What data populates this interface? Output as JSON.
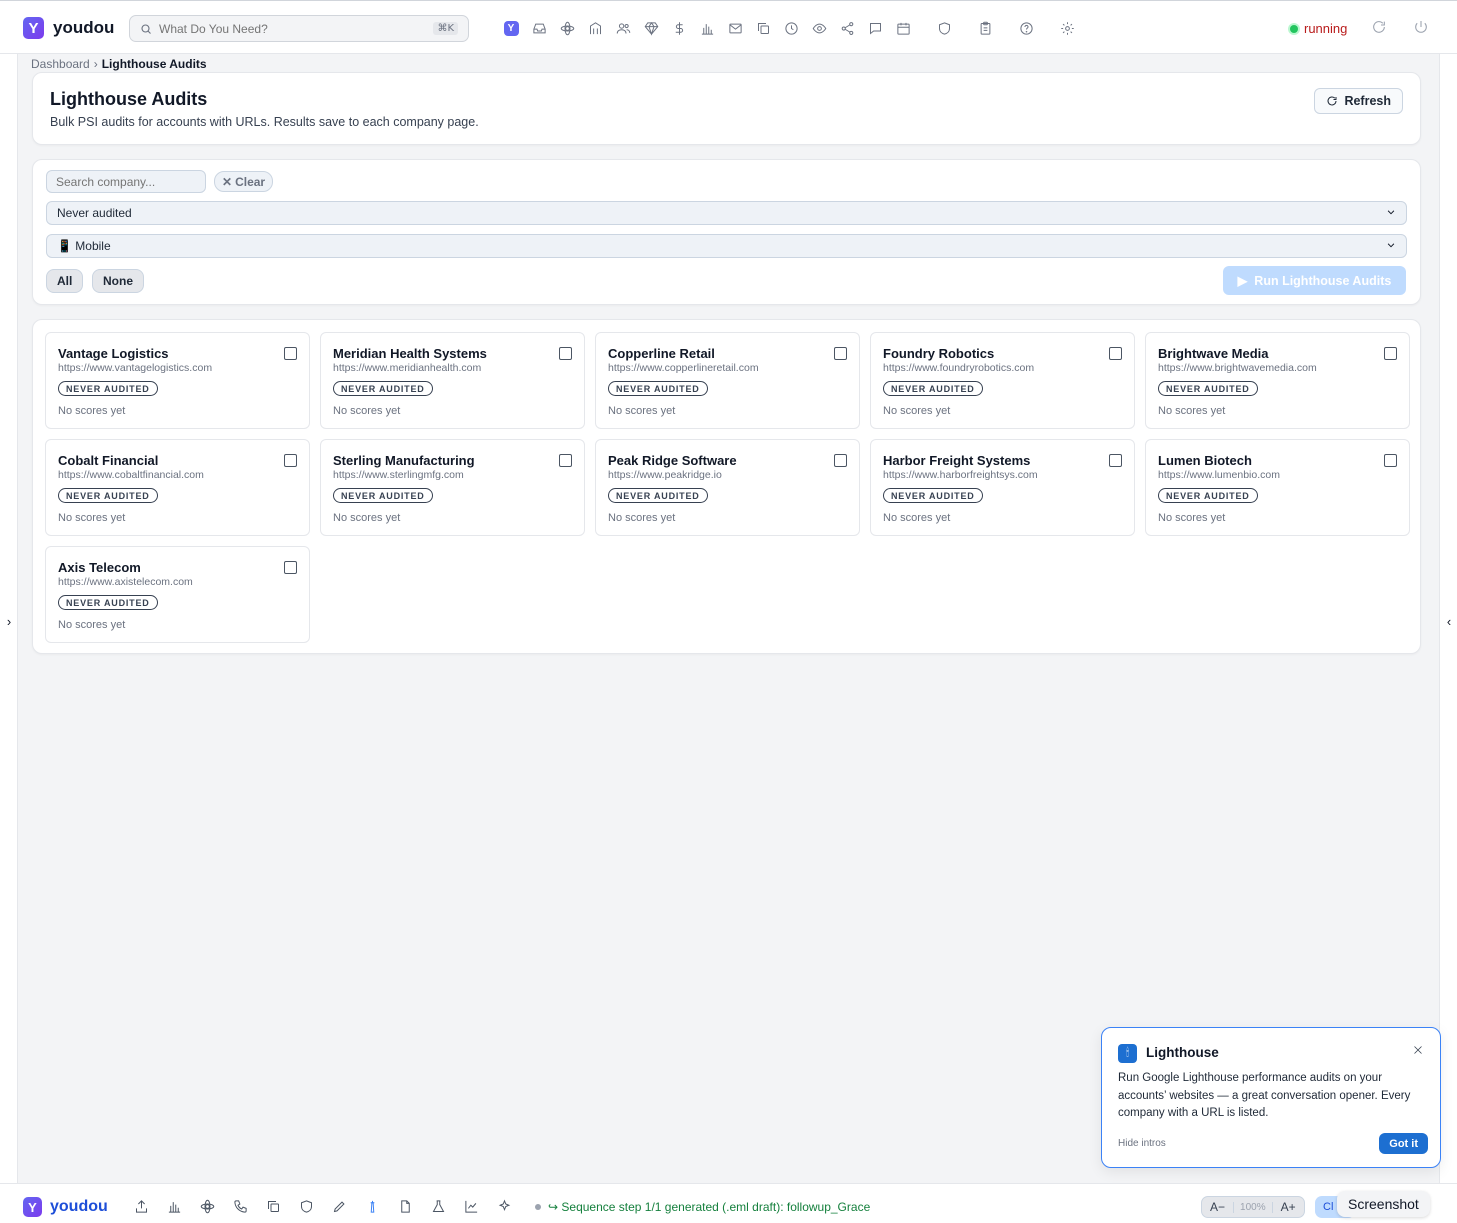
{
  "app": {
    "brand": "youdou"
  },
  "topbar": {
    "search_placeholder": "What Do You Need?",
    "search_shortcut": "⌘K",
    "status": "running",
    "icons": [
      "youdou-home-icon",
      "inbox-icon",
      "network-icon",
      "building-icon",
      "users-icon",
      "gem-icon",
      "dollar-icon",
      "bar-chart-icon",
      "mail-icon",
      "copy-icon",
      "clock-icon",
      "eye-icon",
      "share-icon",
      "message-icon",
      "calendar-icon",
      "shield-icon",
      "clipboard-icon",
      "help-icon",
      "settings-icon"
    ]
  },
  "breadcrumb": {
    "parent": "Dashboard",
    "separator": "›",
    "current": "Lighthouse Audits"
  },
  "header": {
    "title": "Lighthouse Audits",
    "subtitle": "Bulk PSI audits for accounts with URLs. Results save to each company page.",
    "refresh_label": "Refresh"
  },
  "filters": {
    "search_placeholder": "Search company...",
    "clear_label": "Clear",
    "audit_filter": "Never audited",
    "device": "📱 Mobile",
    "select_all_label": "All",
    "select_none_label": "None",
    "run_label": "Run Lighthouse Audits"
  },
  "companies": [
    {
      "name": "Vantage Logistics",
      "url": "https://www.vantagelogistics.com",
      "badge": "NEVER AUDITED",
      "scores": "No scores yet"
    },
    {
      "name": "Meridian Health Systems",
      "url": "https://www.meridianhealth.com",
      "badge": "NEVER AUDITED",
      "scores": "No scores yet"
    },
    {
      "name": "Copperline Retail",
      "url": "https://www.copperlineretail.com",
      "badge": "NEVER AUDITED",
      "scores": "No scores yet"
    },
    {
      "name": "Foundry Robotics",
      "url": "https://www.foundryrobotics.com",
      "badge": "NEVER AUDITED",
      "scores": "No scores yet"
    },
    {
      "name": "Brightwave Media",
      "url": "https://www.brightwavemedia.com",
      "badge": "NEVER AUDITED",
      "scores": "No scores yet"
    },
    {
      "name": "Cobalt Financial",
      "url": "https://www.cobaltfinancial.com",
      "badge": "NEVER AUDITED",
      "scores": "No scores yet"
    },
    {
      "name": "Sterling Manufacturing",
      "url": "https://www.sterlingmfg.com",
      "badge": "NEVER AUDITED",
      "scores": "No scores yet"
    },
    {
      "name": "Peak Ridge Software",
      "url": "https://www.peakridge.io",
      "badge": "NEVER AUDITED",
      "scores": "No scores yet"
    },
    {
      "name": "Harbor Freight Systems",
      "url": "https://www.harborfreightsys.com",
      "badge": "NEVER AUDITED",
      "scores": "No scores yet"
    },
    {
      "name": "Lumen Biotech",
      "url": "https://www.lumenbio.com",
      "badge": "NEVER AUDITED",
      "scores": "No scores yet"
    },
    {
      "name": "Axis Telecom",
      "url": "https://www.axistelecom.com",
      "badge": "NEVER AUDITED",
      "scores": "No scores yet"
    }
  ],
  "intro_popup": {
    "title": "Lighthouse",
    "body": "Run Google Lighthouse performance audits on your accounts’ websites — a great conversation opener. Every company with a URL is listed.",
    "hide_label": "Hide intros",
    "got_it_label": "Got it"
  },
  "bottombar": {
    "brand": "youdou",
    "status": "↪ Sequence step 1/1 generated (.eml draft): followup_Grace",
    "zoom_out": "A−",
    "zoom_level": "100%",
    "zoom_in": "A+",
    "cl_label": "Cl",
    "tooltip": "Screenshot"
  },
  "colors": {
    "accent": "#1d6fd1",
    "brand": "#6366f1",
    "status_running": "#b91c1c",
    "run_disabled": "#bfdbfe"
  }
}
